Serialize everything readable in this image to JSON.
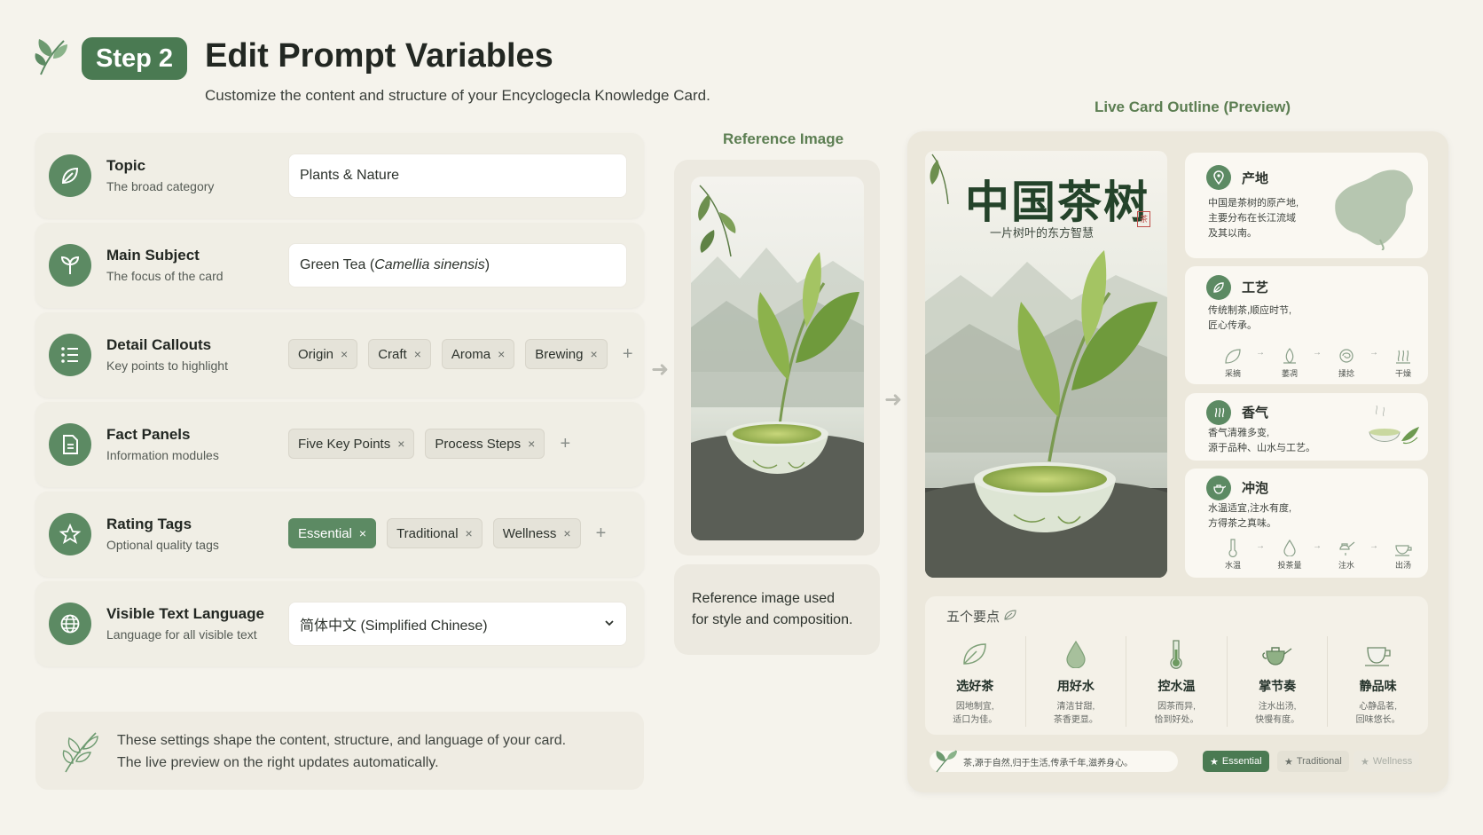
{
  "header": {
    "step_label": "Step 2",
    "title": "Edit Prompt Variables",
    "subtitle": "Customize the content and structure of your Encyclogecla Knowledge Card."
  },
  "fields": {
    "topic": {
      "label": "Topic",
      "description": "The broad category",
      "value": "Plants & Nature"
    },
    "main_subject": {
      "label": "Main Subject",
      "description": "The focus of the card",
      "value_plain": "Green Tea (",
      "value_italic": "Camellia sinensis",
      "value_close": ")"
    },
    "detail_callouts": {
      "label": "Detail Callouts",
      "description": "Key points to highlight",
      "chips": [
        "Origin",
        "Craft",
        "Aroma",
        "Brewing"
      ]
    },
    "fact_panels": {
      "label": "Fact Panels",
      "description": "Information modules",
      "chips": [
        "Five Key Points",
        "Process Steps"
      ]
    },
    "rating_tags": {
      "label": "Rating Tags",
      "description": "Optional quality tags",
      "chips": [
        "Essential",
        "Traditional",
        "Wellness"
      ]
    },
    "language": {
      "label": "Visible Text Language",
      "description": "Language for all visible text",
      "value": "简体中文 (Simplified Chinese)"
    }
  },
  "chip_remove_glyph": "×",
  "add_glyph": "+",
  "arrow_glyph": "➜",
  "info": {
    "line1": "These settings shape the content, structure, and language of your card.",
    "line2": "The live preview on the right updates automatically."
  },
  "reference": {
    "title": "Reference Image",
    "caption_line1": "Reference image used",
    "caption_line2": "for style and composition."
  },
  "preview": {
    "title": "Live Card Outline (Preview)",
    "card_title": "中国茶树",
    "card_subtitle": "一片树叶的东方智慧",
    "seal": "茶",
    "origin": {
      "title": "产地",
      "text1": "中国是茶树的原产地,",
      "text2": "主要分布在长江流域",
      "text3": "及其以南。"
    },
    "craft": {
      "title": "工艺",
      "text1": "传统制茶,顺应时节,",
      "text2": "匠心传承。",
      "steps": [
        "采摘",
        "萎凋",
        "揉捻",
        "干燥"
      ]
    },
    "aroma": {
      "title": "香气",
      "text1": "香气清雅多变,",
      "text2": "源于品种、山水与工艺。"
    },
    "brewing": {
      "title": "冲泡",
      "text1": "水温适宜,注水有度,",
      "text2": "方得茶之真味。",
      "steps": [
        "水温",
        "投茶量",
        "注水",
        "出汤"
      ]
    },
    "five_points": {
      "title": "五个要点",
      "items": [
        {
          "name": "选好茶",
          "desc1": "因地制宜,",
          "desc2": "适口为佳。"
        },
        {
          "name": "用好水",
          "desc1": "清洁甘甜,",
          "desc2": "茶香更显。"
        },
        {
          "name": "控水温",
          "desc1": "因茶而异,",
          "desc2": "恰到好处。"
        },
        {
          "name": "掌节奏",
          "desc1": "注水出汤,",
          "desc2": "快慢有度。"
        },
        {
          "name": "静品味",
          "desc1": "心静品茗,",
          "desc2": "回味悠长。"
        }
      ]
    },
    "footer_text": "茶,源于自然,归于生活,传承千年,滋养身心。",
    "tags": [
      "Essential",
      "Traditional",
      "Wellness"
    ]
  },
  "colors": {
    "accent": "#5c8a63",
    "background": "#f5f3ec",
    "title_green": "#5c7e52"
  }
}
